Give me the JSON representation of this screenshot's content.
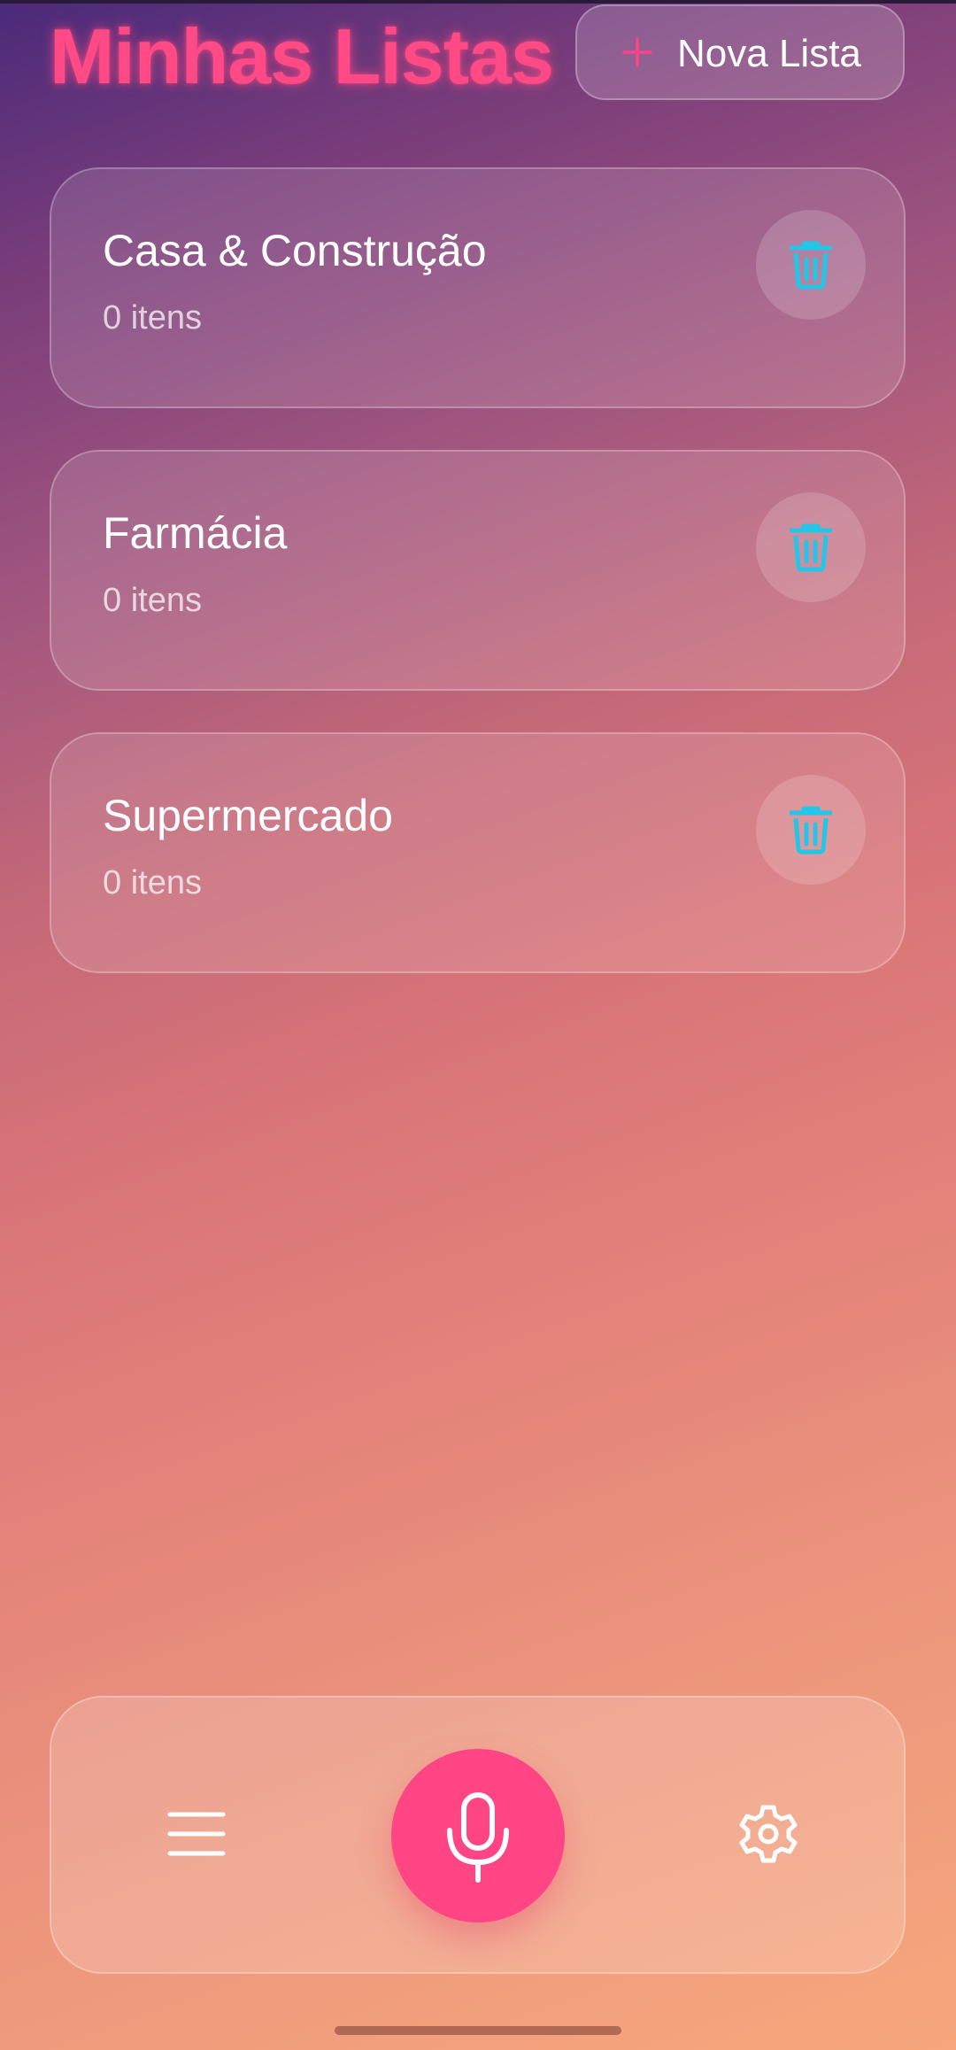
{
  "header": {
    "title": "Minhas Listas",
    "new_list_label": "Nova Lista"
  },
  "lists": [
    {
      "title": "Casa & Construção",
      "count": "0 itens"
    },
    {
      "title": "Farmácia",
      "count": "0 itens"
    },
    {
      "title": "Supermercado",
      "count": "0 itens"
    }
  ],
  "bottom_bar": {
    "icons": [
      "menu-icon",
      "microphone-icon",
      "settings-gear-icon"
    ]
  },
  "colors": {
    "accent_pink": "#ff4584",
    "trash_cyan": "#22c6e8",
    "text_white": "#ffffff"
  }
}
